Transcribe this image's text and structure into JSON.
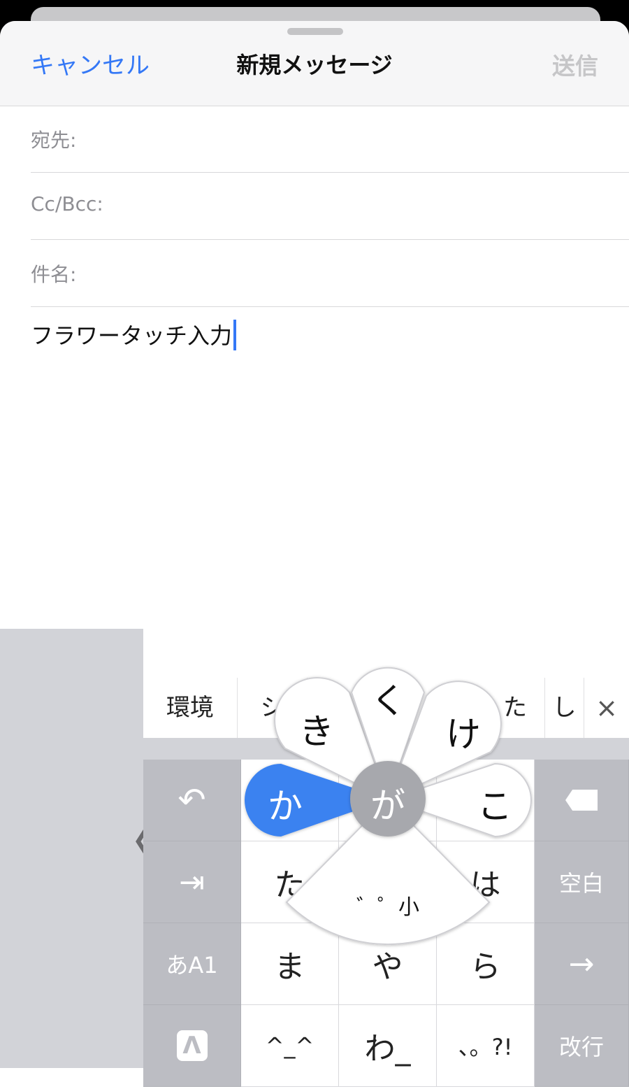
{
  "nav": {
    "cancel": "キャンセル",
    "title": "新規メッセージ",
    "send": "送信"
  },
  "fields": {
    "to": "宛先:",
    "ccbcc": "Cc/Bcc:",
    "subject": "件名:"
  },
  "body": "フラワータッチ入力",
  "keyboard": {
    "back_glyph": "〈",
    "candidates": [
      "環境",
      "シ",
      "た",
      "し"
    ],
    "close_glyph": "×",
    "left_col": [
      "↶",
      "⇥",
      "あA1",
      "Λ"
    ],
    "center_keys": [
      [
        "か",
        "",
        ""
      ],
      [
        "た",
        "",
        "は"
      ],
      [
        "ま",
        "や",
        "ら"
      ],
      [
        "^_^",
        "わ_",
        "、。?!"
      ]
    ],
    "right_col": [
      "⌫",
      "空白",
      "→",
      "改行"
    ],
    "flower": {
      "center": "が",
      "left": "か",
      "up_left": "き",
      "up": "く",
      "up_right": "け",
      "right": "こ",
      "bottom": "゛゜小"
    }
  },
  "colors": {
    "accent": "#3478f6",
    "key_gray": "#bcbdc3",
    "petal": "#ffffff",
    "center": "#a7a8ad"
  }
}
